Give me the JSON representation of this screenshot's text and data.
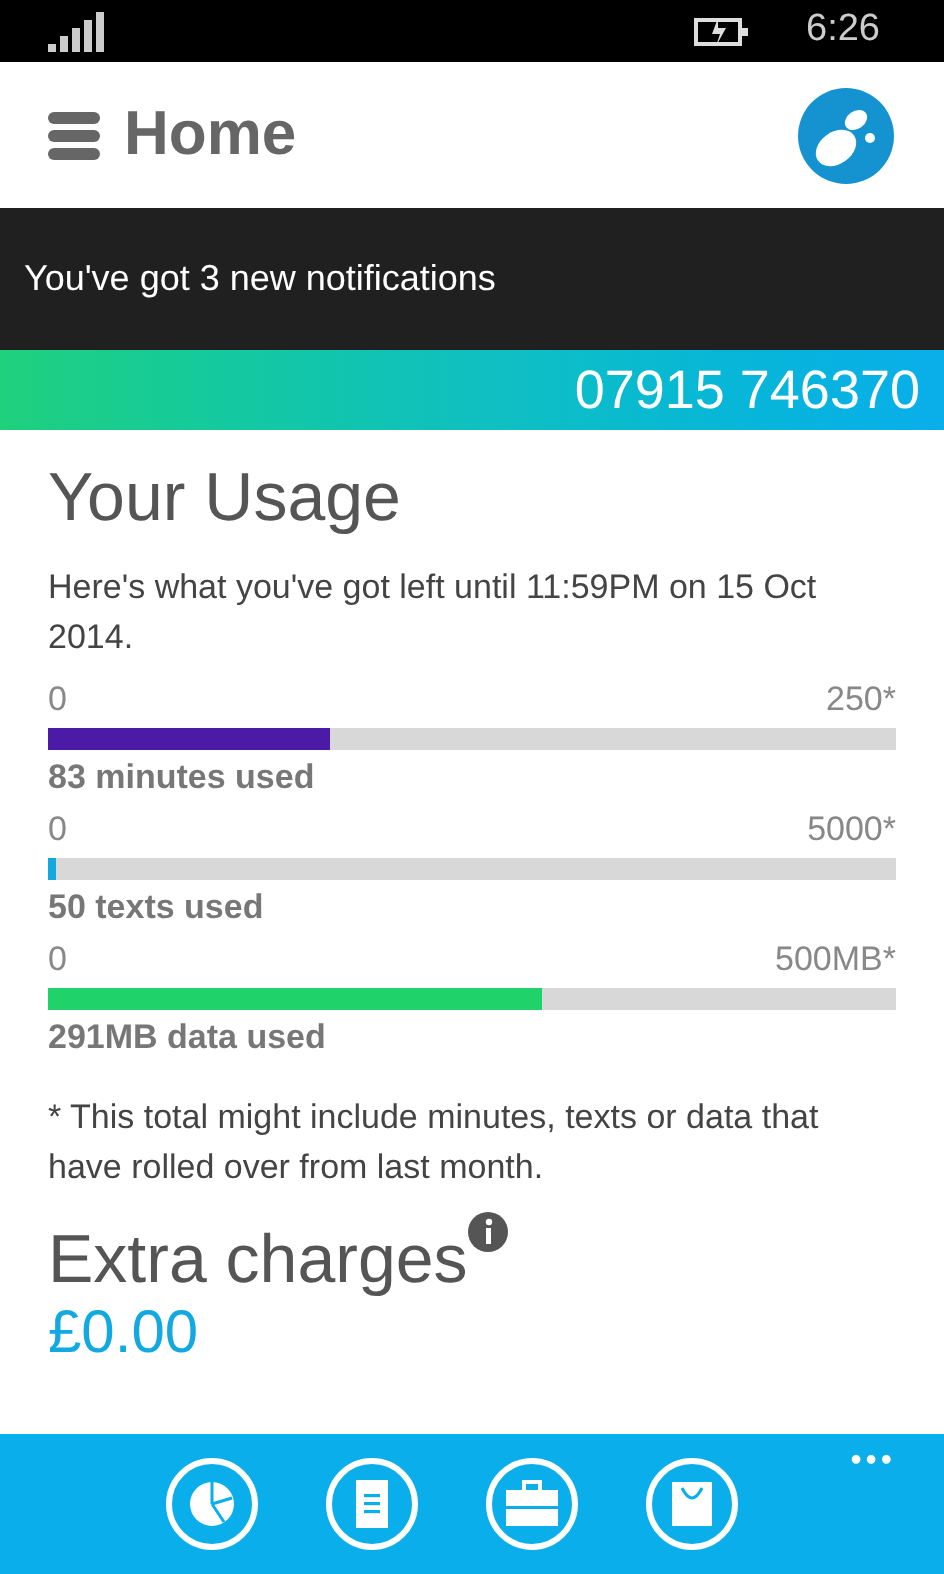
{
  "status_bar": {
    "time": "6:26"
  },
  "header": {
    "title": "Home"
  },
  "notification": {
    "text": "You've got 3 new notifications"
  },
  "phone_number": "07915 746370",
  "usage": {
    "title": "Your Usage",
    "intro": "Here's what you've got left until 11:59PM on 15 Oct 2014.",
    "meters": [
      {
        "min": "0",
        "max": "250*",
        "level": 0.332,
        "color": "#4b1aa6",
        "caption": "83 minutes used"
      },
      {
        "min": "0",
        "max": "5000*",
        "level": 0.01,
        "color": "#11a9df",
        "caption": "50 texts used"
      },
      {
        "min": "0",
        "max": "500MB*",
        "level": 0.582,
        "color": "#1fd36a",
        "caption": "291MB data used"
      }
    ],
    "footnote": "* This total might include minutes, texts or data that have rolled over from last month."
  },
  "extra_charges": {
    "title": "Extra charges",
    "amount": "£0.00"
  },
  "app_bar": {
    "buttons": [
      {
        "kind": "pie"
      },
      {
        "kind": "document"
      },
      {
        "kind": "briefcase"
      },
      {
        "kind": "bag"
      }
    ],
    "more": "•••"
  }
}
